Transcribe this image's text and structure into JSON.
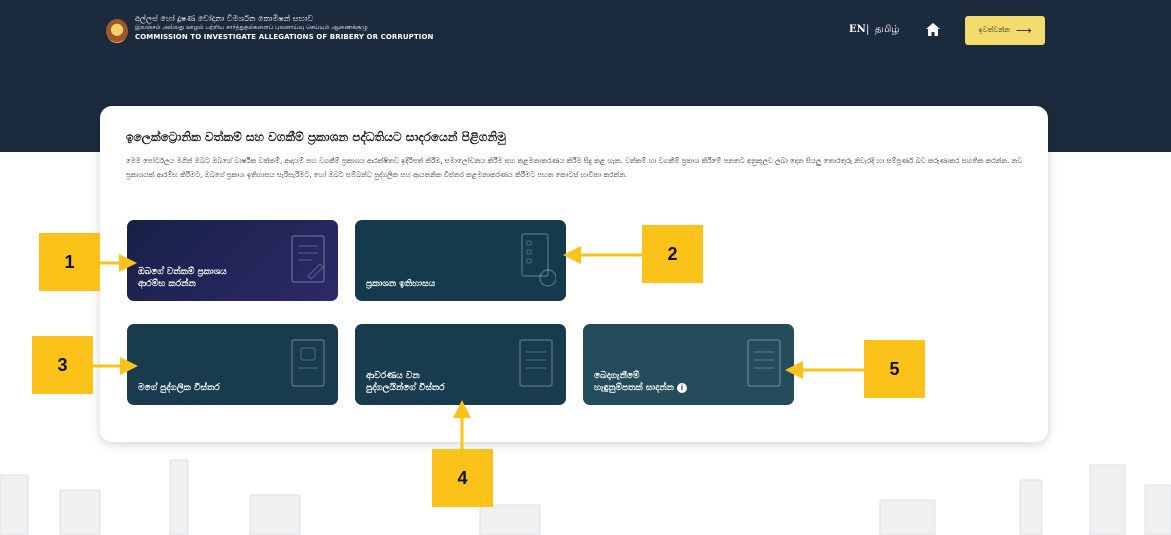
{
  "header": {
    "org_si": "අල්ලස් හෝ දූෂණ චෝදනා විමර්ශන කොමිෂන් සභාව",
    "org_ta": "இலஞ்சம் அல்லது ஊழல் பற்றிய சார்த்துதல்களைப் புலனாய்வு செய்யும் ஆணைக்குழு",
    "org_en": "COMMISSION TO INVESTIGATE ALLEGATIONS OF BRIBERY OR CORRUPTION",
    "lang_en": "EN",
    "lang_sep": "|",
    "lang_ta": "தமிழ்",
    "login_label": "ඉවත්වන්න"
  },
  "main": {
    "title": "ඉලෙක්ට්‍රොනික වත්කම් සහ වගකීම් ප්‍රකාශන පද්ධතියට සාදරයෙන් පිළිගනිමු",
    "description": "මෙම පෝර්ටලය මගින් ඔබට ඔබගේ වාර්ෂික වත්කම්, ආදායම් සහ වගකීම් ප්‍රකාශය ආරක්ෂිතව ඉදිරිපත් කිරීම, සමාලෝචනය කිරීම සහ කළමනාකරණය කිරීම සිදු කළ හැක. වත්කම් හා වගකීම් ප්‍රකාශ කිරීමේ පනතට අනුකූලව ලබා දෙන සියලු තොරතුරු නිවැරදි හා සම්පූර්ණ බව කරුණාකර සහතික කරන්න. නව ප්‍රකාශයක් ආරම්භ කිරීමට, ඔබගේ ප්‍රකාශ ඉතිහාසය සැරිසැරීමට, හෝ ඔබට සම්බන්ධ පුද්ගලික සහ ආයතනික විස්තර කළමනාකරණය කිරීමට පහත කොටස් භාවිතා කරන්න.",
    "tiles": [
      {
        "label": "ඔබගේ වත්කම් ප්‍රකාශය\nආරම්භ කරන්න"
      },
      {
        "label": "ප්‍රකාශන ඉතිහාසය"
      },
      {
        "label": "මගේ පුද්ගලික විස්තර"
      },
      {
        "label": "ආවරණය වන\nපුද්ගලයින්ගේ විස්තර"
      },
      {
        "label": "බෙදාගැනීමේ\nහැඳුනුම්පතක් සාදන්න"
      }
    ]
  },
  "callouts": [
    "1",
    "2",
    "3",
    "4",
    "5"
  ],
  "colors": {
    "header_bg": "#1c2a3e",
    "accent_yellow": "#fbc21a",
    "login_bg": "#f4dc6c",
    "tile_primary": "#172046",
    "tile_secondary": "#143a4c"
  },
  "icons": {
    "home": "home-icon",
    "arrow": "arrow-right-icon",
    "document": "document-icon",
    "history": "history-icon",
    "user": "user-profile-icon",
    "info": "info-icon"
  }
}
